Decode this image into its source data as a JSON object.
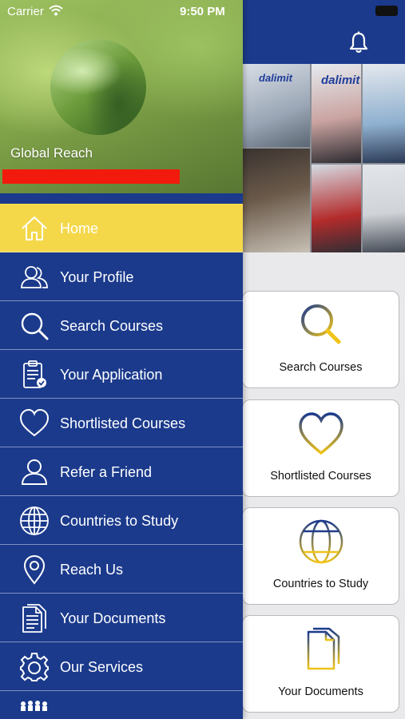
{
  "status_bar": {
    "carrier": "Carrier",
    "time": "9:50 PM"
  },
  "drawer": {
    "user_name": "Global Reach",
    "menu": [
      {
        "label": "Home",
        "icon": "home-icon",
        "active": true
      },
      {
        "label": "Your Profile",
        "icon": "users-icon"
      },
      {
        "label": "Search Courses",
        "icon": "search-icon"
      },
      {
        "label": "Your Application",
        "icon": "clipboard-icon"
      },
      {
        "label": "Shortlisted Courses",
        "icon": "heart-icon"
      },
      {
        "label": "Refer a Friend",
        "icon": "user-icon"
      },
      {
        "label": "Countries to Study",
        "icon": "globe-icon"
      },
      {
        "label": "Reach Us",
        "icon": "location-pin-icon"
      },
      {
        "label": "Your Documents",
        "icon": "document-icon"
      },
      {
        "label": "Our Services",
        "icon": "gear-icon"
      }
    ]
  },
  "main": {
    "hero_brand": [
      "dalimit",
      "dalimit"
    ],
    "cards": [
      {
        "label": "Search Courses",
        "icon": "search-icon"
      },
      {
        "label": "Shortlisted Courses",
        "icon": "heart-icon"
      },
      {
        "label": "Countries to Study",
        "icon": "globe-icon"
      },
      {
        "label": "Your Documents",
        "icon": "document-icon"
      }
    ]
  },
  "colors": {
    "brand_blue": "#1b3a8c",
    "active_yellow": "#f4d84a",
    "redaction": "#f21a0c"
  }
}
